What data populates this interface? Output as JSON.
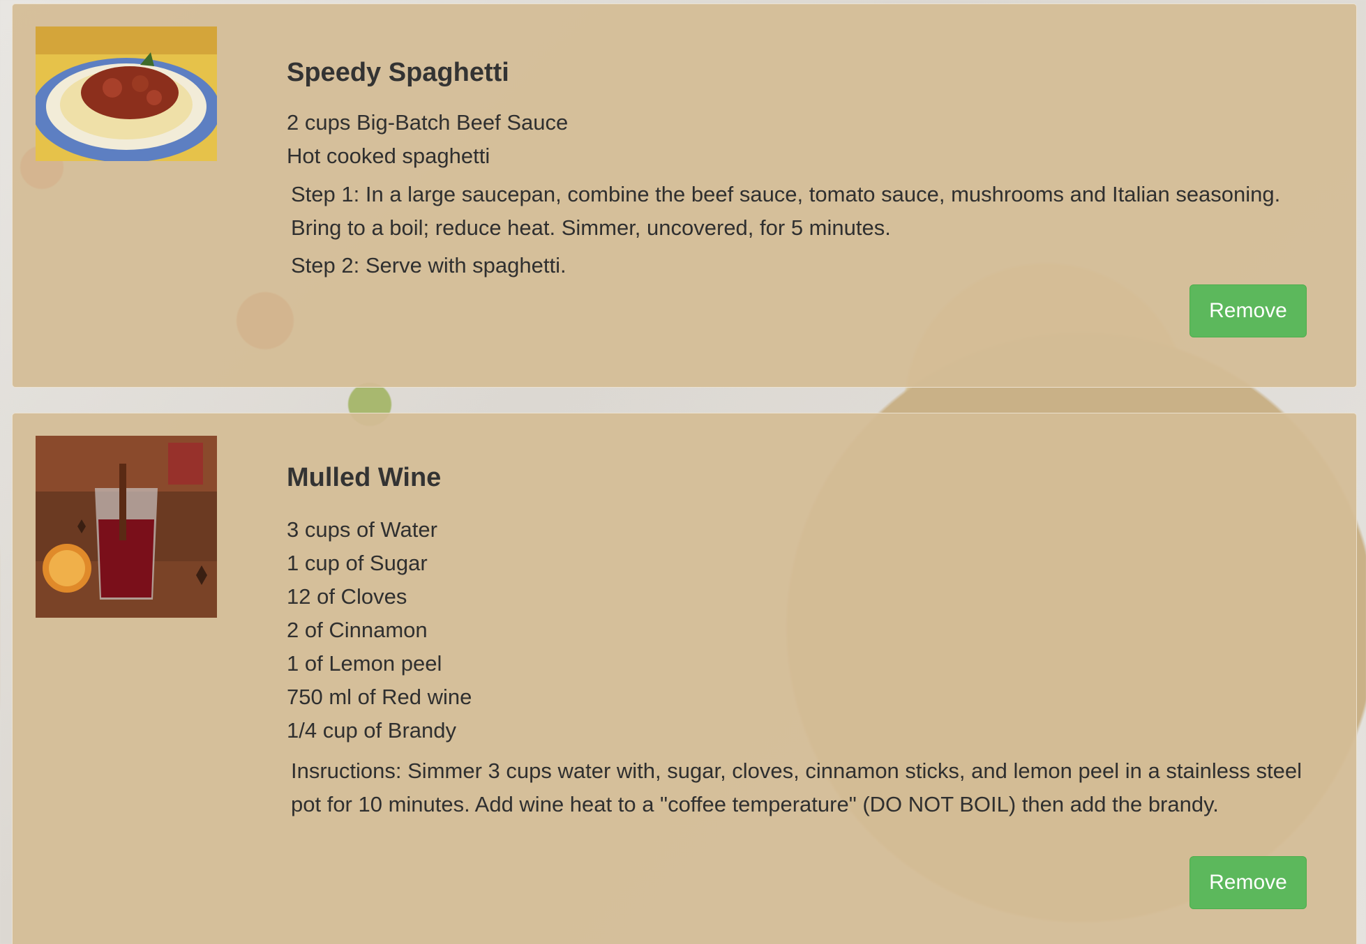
{
  "recipes": [
    {
      "title": "Speedy Spaghetti",
      "ingredients": [
        "2 cups Big-Batch Beef Sauce",
        "Hot cooked spaghetti"
      ],
      "instructions": [
        "Step 1: In a large saucepan, combine the beef sauce, tomato sauce, mushrooms and Italian seasoning. Bring to a boil; reduce heat. Simmer, uncovered, for 5 minutes.",
        "Step 2: Serve with spaghetti."
      ],
      "remove_label": "Remove"
    },
    {
      "title": "Mulled Wine",
      "ingredients": [
        "3 cups of Water",
        "1 cup of Sugar",
        "12 of Cloves",
        "2 of Cinnamon",
        "1 of Lemon peel",
        "750 ml of Red wine",
        "1/4 cup of Brandy"
      ],
      "instructions": [
        "Insructions: Simmer 3 cups water with, sugar, cloves, cinnamon sticks, and lemon peel in a stainless steel pot for 10 minutes. Add wine heat to a \"coffee temperature\" (DO NOT BOIL) then add the brandy."
      ],
      "remove_label": "Remove"
    }
  ],
  "colors": {
    "card_background": "#d4bc96",
    "button_green": "#5cb85c",
    "text": "#2f2f2f"
  }
}
